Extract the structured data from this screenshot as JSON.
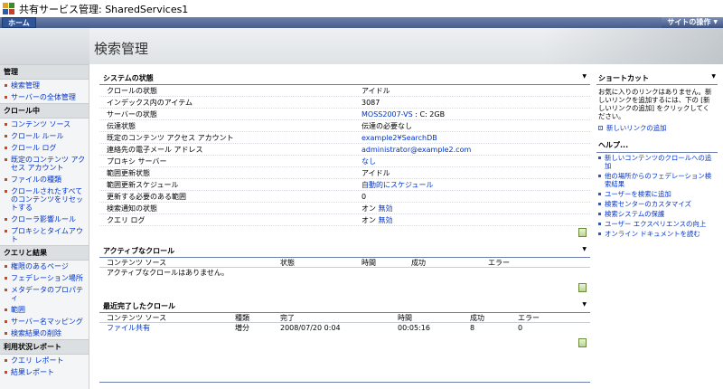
{
  "site": {
    "title": "共有サービス管理: SharedServices1"
  },
  "nav": {
    "home_label": "ホーム",
    "site_actions_label": "サイトの操作"
  },
  "page": {
    "title": "検索管理"
  },
  "leftnav": {
    "groups": [
      {
        "title": "管理",
        "items": [
          "検索管理",
          "サーバーの全体管理"
        ]
      },
      {
        "title": "クロール中",
        "items": [
          "コンテンツ ソース",
          "クロール ルール",
          "クロール ログ",
          "既定のコンテンツ アクセス アカウント",
          "ファイルの種類",
          "クロールされたすべてのコンテンツをリセットする",
          "クローラ影響ルール",
          "プロキシとタイムアウト"
        ]
      },
      {
        "title": "クエリと結果",
        "items": [
          "権限のあるページ",
          "フェデレーション場所",
          "メタデータのプロパティ",
          "範囲",
          "サーバー名マッピング",
          "検索結果の削除"
        ]
      },
      {
        "title": "利用状況レポート",
        "items": [
          "クエリ レポート",
          "結果レポート"
        ]
      }
    ]
  },
  "system_status": {
    "title": "システムの状態",
    "rows": [
      {
        "key": "クロールの状態",
        "value": "アイドル",
        "link": ""
      },
      {
        "key": "インデックス内のアイテム",
        "value": "3087",
        "link": ""
      },
      {
        "key": "サーバーの状態",
        "value": " : C: 2GB",
        "link": "MOSS2007-VS"
      },
      {
        "key": "伝達状態",
        "value": "伝達の必要なし",
        "link": ""
      },
      {
        "key": "既定のコンテンツ アクセス アカウント",
        "value": "",
        "link": "example2¥SearchDB"
      },
      {
        "key": "連絡先の電子メール アドレス",
        "value": "",
        "link": "administrator@example2.com"
      },
      {
        "key": "プロキシ サーバー",
        "value": "",
        "link": "なし"
      },
      {
        "key": "範囲更新状態",
        "value": "アイドル",
        "link": ""
      },
      {
        "key": "範囲更新スケジュール",
        "value": "",
        "link": "自動的にスケジュール"
      },
      {
        "key": "更新する必要のある範囲",
        "value": "0",
        "link": ""
      },
      {
        "key": "検索通知の状態",
        "value": "オン ",
        "link": "無効"
      },
      {
        "key": "クエリ ログ",
        "value": "オン ",
        "link": "無効"
      }
    ]
  },
  "active_crawls": {
    "title": "アクティブなクロール",
    "headers": [
      "コンテンツ ソース",
      "状態",
      "時間",
      "成功",
      "エラー"
    ],
    "empty_text": "アクティブなクロールはありません。"
  },
  "recent_crawls": {
    "title": "最近完了したクロール",
    "headers": [
      "コンテンツ ソース",
      "種類",
      "完了",
      "時間",
      "成功",
      "エラー"
    ],
    "rows": [
      {
        "source": "ファイル共有",
        "type": "増分",
        "completed": "2008/07/20 0:04",
        "duration": "00:05:16",
        "success": "8",
        "errors": "0"
      }
    ]
  },
  "shortcuts": {
    "title": "ショートカット",
    "text": "お気に入りのリンクはありません。新しいリンクを追加するには、下の [新しいリンクの追加] をクリックしてください。",
    "add_link": "新しいリンクの追加"
  },
  "help": {
    "title": "ヘルプ...",
    "items": [
      "新しいコンテンツのクロールへの追加",
      "他の場所からのフェデレーション検索結果",
      "ユーザーを検索に追加",
      "検索センターのカスタマイズ",
      "検索システムの保護",
      "ユーザー エクスペリエンスの向上",
      "オンライン ドキュメントを読む"
    ]
  },
  "colors": {
    "navbar": "#4a5e8c",
    "link": "#0033cc",
    "bullet": "#d0451b"
  }
}
